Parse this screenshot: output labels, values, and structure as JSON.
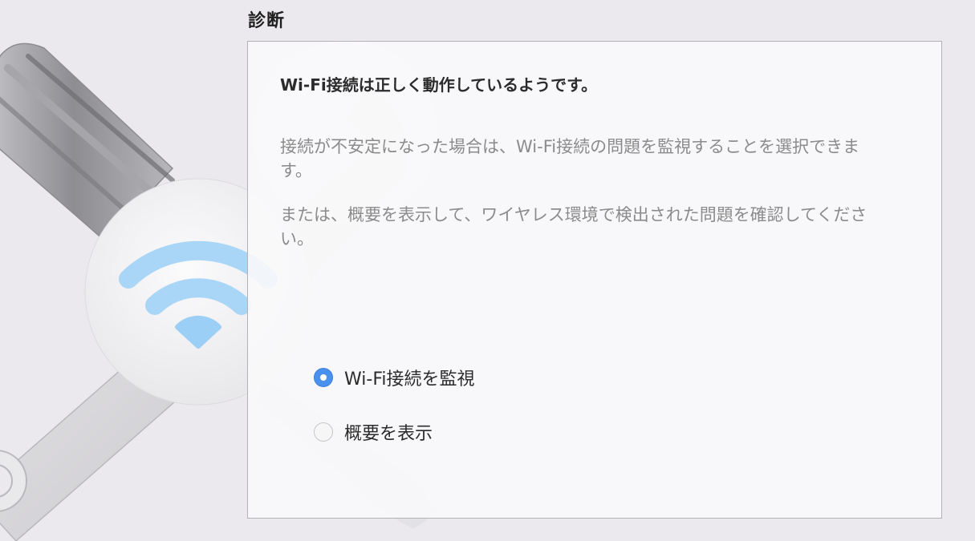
{
  "section": {
    "title": "診断"
  },
  "panel": {
    "headline": "Wi-Fi接続は正しく動作しているようです。",
    "paragraph1": "接続が不安定になった場合は、Wi-Fi接続の問題を監視することを選択できます。",
    "paragraph2": "または、概要を表示して、ワイヤレス環境で検出された問題を確認してください。"
  },
  "options": [
    {
      "label": "Wi-Fi接続を監視",
      "selected": true
    },
    {
      "label": "概要を表示",
      "selected": false
    }
  ],
  "colors": {
    "background": "#ebe9ed",
    "accent": "#4a90ee",
    "wifi_icon": "#8fc9f5"
  },
  "icons": {
    "background_art": "wrench-screwdriver-icon",
    "wifi": "wifi-icon"
  }
}
